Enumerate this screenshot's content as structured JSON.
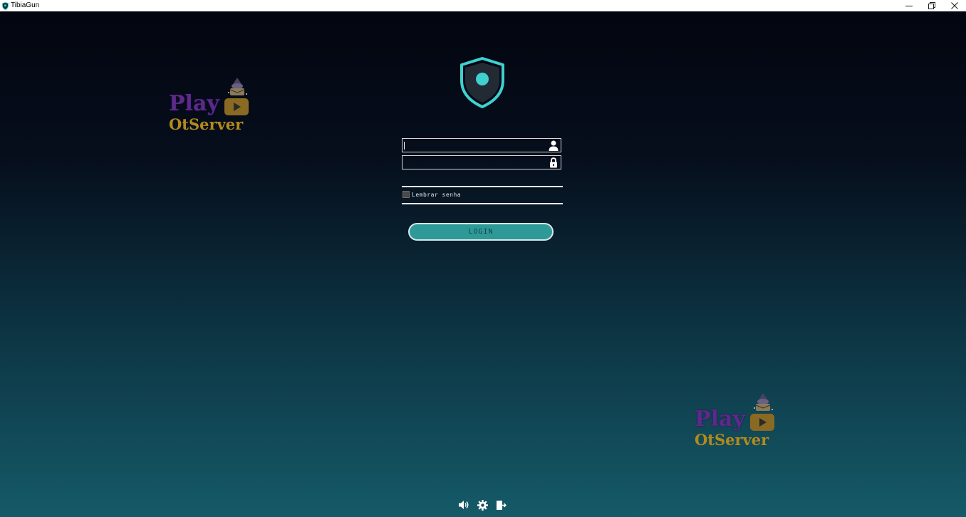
{
  "window": {
    "title": "TibiaGun",
    "controls": [
      "minimize-icon",
      "restore-icon",
      "close-icon"
    ]
  },
  "login": {
    "username_value": "",
    "password_value": "",
    "remember_label": "Lembrar senha",
    "remember_checked": false,
    "button_label": "LOGIN"
  },
  "logos": [
    {
      "play": "Play",
      "otserver": "OtServer"
    },
    {
      "play": "Play",
      "otserver": "OtServer"
    }
  ],
  "icons": {
    "app": "shield-icon",
    "user": "user-icon",
    "lock": "lock-icon",
    "sound": "speaker-icon",
    "settings": "gear-icon",
    "exit": "exit-icon"
  },
  "colors": {
    "accent": "#2e9a98",
    "shield": "#3fd0cf",
    "shield_fill": "#1f2a36",
    "background_top": "#03050f",
    "background_bottom": "#155a68"
  }
}
